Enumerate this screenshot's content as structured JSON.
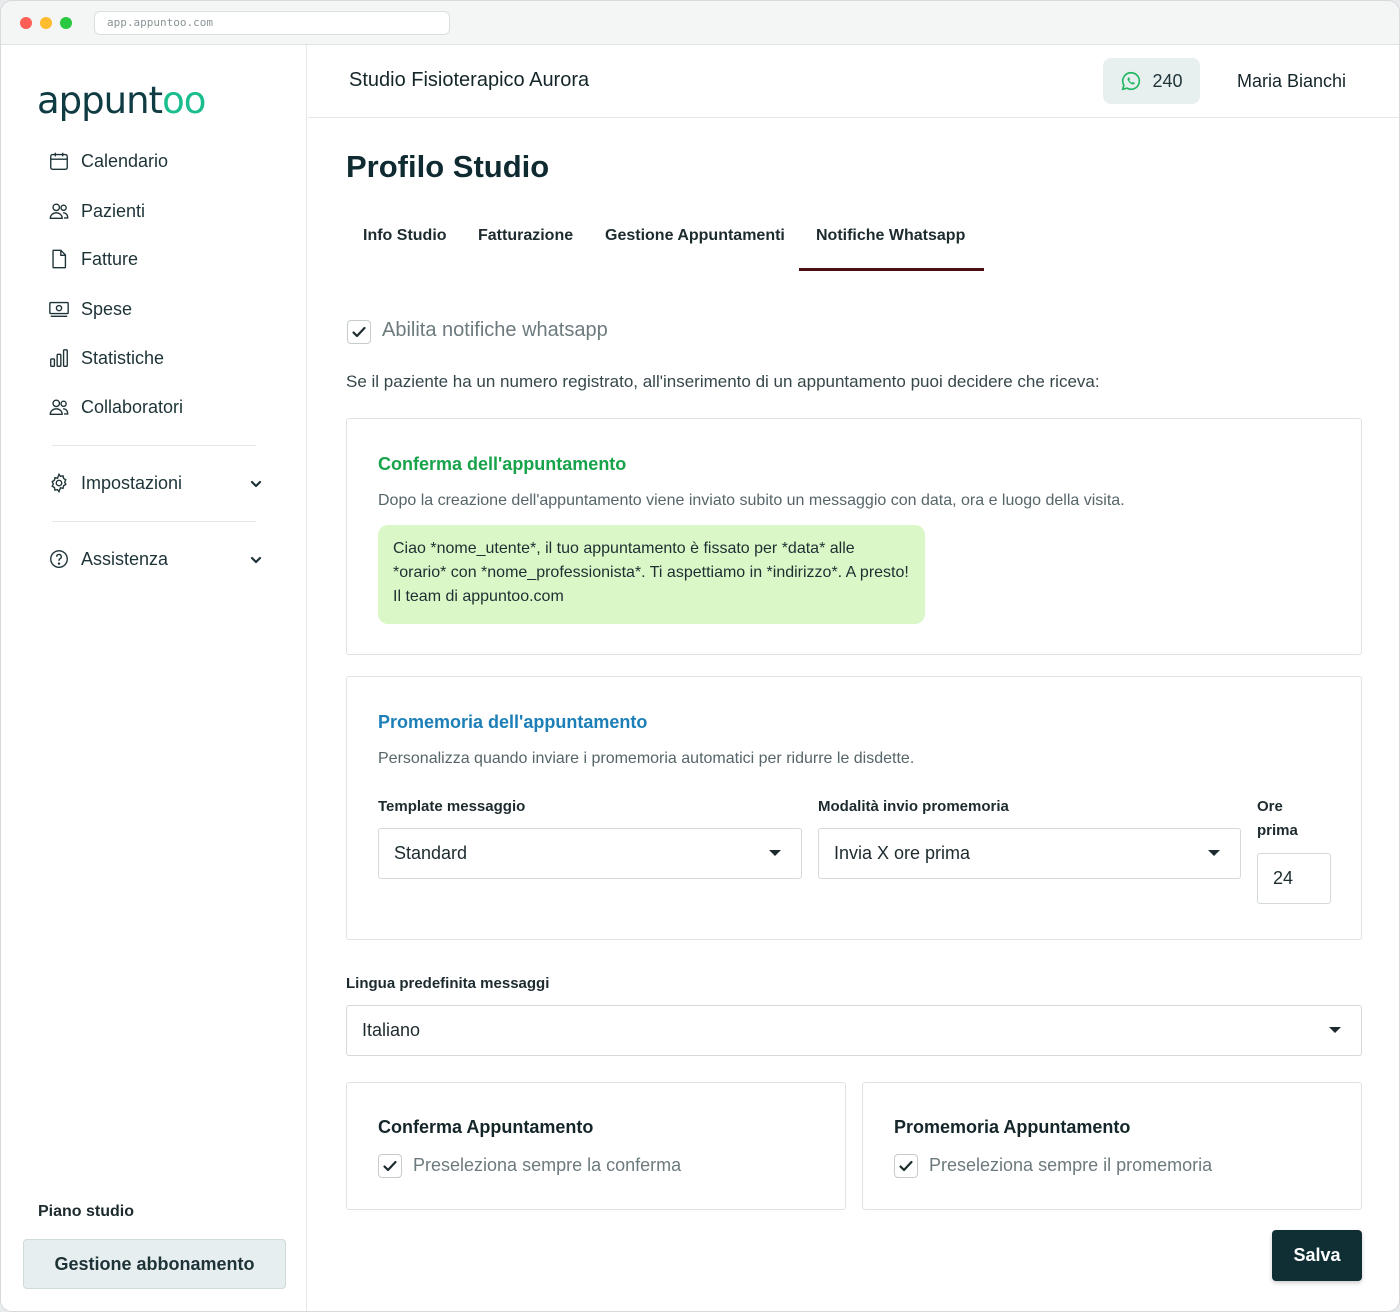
{
  "browser": {
    "url": "app.appuntoo.com"
  },
  "sidebar": {
    "logo_prefix": "appunt",
    "logo_suffix": "oo",
    "items": [
      {
        "label": "Calendario",
        "icon": "calendar-icon"
      },
      {
        "label": "Pazienti",
        "icon": "users-icon"
      },
      {
        "label": "Fatture",
        "icon": "document-icon"
      },
      {
        "label": "Spese",
        "icon": "cash-icon"
      },
      {
        "label": "Statistiche",
        "icon": "bar-chart-icon"
      },
      {
        "label": "Collaboratori",
        "icon": "users-icon"
      }
    ],
    "settings_label": "Impostazioni",
    "help_label": "Assistenza",
    "plan_label": "Piano studio",
    "plan_button": "Gestione abbonamento"
  },
  "header": {
    "studio_name": "Studio Fisioterapico Aurora",
    "credits": "240",
    "user_name": "Maria Bianchi"
  },
  "page": {
    "title": "Profilo Studio",
    "tabs": [
      "Info Studio",
      "Fatturazione",
      "Gestione Appuntamenti",
      "Notifiche Whatsapp"
    ],
    "active_tab": "Notifiche Whatsapp"
  },
  "notifications": {
    "enable_label": "Abilita notifiche whatsapp",
    "intro": "Se il paziente ha un numero registrato, all'inserimento di un appuntamento puoi decidere che riceva:",
    "confirm_card": {
      "title": "Conferma dell'appuntamento",
      "description": "Dopo la creazione dell'appuntamento viene inviato subito un messaggio con data, ora e luogo della visita.",
      "message": "Ciao *nome_utente*, il tuo appuntamento è fissato per *data* alle *orario* con *nome_professionista*. Ti aspettiamo in *indirizzo*. A presto! Il team di appuntoo.com"
    },
    "reminder_card": {
      "title": "Promemoria dell'appuntamento",
      "description": "Personalizza quando inviare i promemoria automatici per ridurre le disdette.",
      "template_label": "Template messaggio",
      "template_value": "Standard",
      "mode_label": "Modalità invio promemoria",
      "mode_value": "Invia X ore prima",
      "hours_label_1": "Ore",
      "hours_label_2": "prima",
      "hours_value": "24"
    },
    "language_label": "Lingua predefinita messaggi",
    "language_value": "Italiano",
    "confirm_default": {
      "title": "Conferma Appuntamento",
      "checkbox_label": "Preseleziona sempre la conferma"
    },
    "reminder_default": {
      "title": "Promemoria Appuntamento",
      "checkbox_label": "Preseleziona sempre il promemoria"
    },
    "save_label": "Salva"
  },
  "colors": {
    "accent_green": "#17a34a",
    "accent_blue": "#1c7fb8",
    "primary_dark": "#0f2f35",
    "bubble": "#daf7c8",
    "tab_underline": "#4a1010"
  }
}
